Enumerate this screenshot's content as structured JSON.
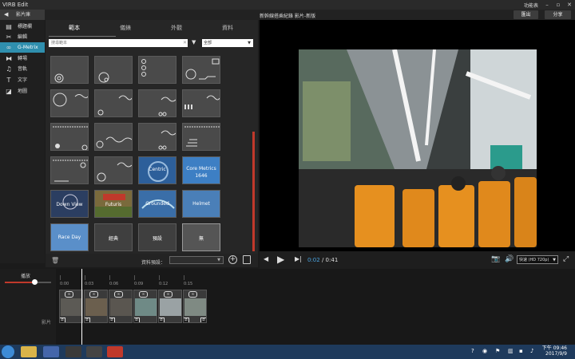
{
  "window": {
    "title": "VIRB Edit",
    "menu_label": "功能表",
    "minimize": "–",
    "maximize": "▫",
    "close": "✕"
  },
  "header": {
    "library_tab": "影片庫",
    "project_name": "新幹線搭乘紀錄 影片-新版",
    "exit_label": "匯出",
    "share_label": "分享"
  },
  "sidebar": {
    "items": [
      {
        "label": "標題欄",
        "icon": "film-strip-icon",
        "glyph": "▤"
      },
      {
        "label": "編輯",
        "icon": "scissors-icon",
        "glyph": "✂"
      },
      {
        "label": "G-Metrix",
        "icon": "gmetrix-icon",
        "glyph": "∞"
      },
      {
        "label": "轉場",
        "icon": "transition-icon",
        "glyph": "⧓"
      },
      {
        "label": "音軌",
        "icon": "music-icon",
        "glyph": "♫"
      },
      {
        "label": "文字",
        "icon": "text-icon",
        "glyph": "T"
      },
      {
        "label": "地圖",
        "icon": "map-icon",
        "glyph": "◪"
      }
    ]
  },
  "gauge_panel": {
    "tabs": [
      "範本",
      "儀錶",
      "外觀",
      "資料"
    ],
    "search_placeholder": "搜尋範本",
    "filter_value": "全部",
    "tiles": [
      {
        "kind": "gauge",
        "label": ""
      },
      {
        "kind": "gauge",
        "label": ""
      },
      {
        "kind": "gauge",
        "label": ""
      },
      {
        "kind": "gauge",
        "label": ""
      },
      {
        "kind": "gauge",
        "label": ""
      },
      {
        "kind": "gauge",
        "label": ""
      },
      {
        "kind": "gauge",
        "label": ""
      },
      {
        "kind": "gauge",
        "label": ""
      },
      {
        "kind": "gauge",
        "label": ""
      },
      {
        "kind": "gauge",
        "label": ""
      },
      {
        "kind": "gauge",
        "label": ""
      },
      {
        "kind": "gauge",
        "label": ""
      },
      {
        "kind": "gauge",
        "label": ""
      },
      {
        "kind": "gauge",
        "label": ""
      },
      {
        "kind": "photo",
        "label": "Centric"
      },
      {
        "kind": "photo",
        "label": "Core Metrics\n1646"
      },
      {
        "kind": "photo",
        "label": "Down View"
      },
      {
        "kind": "photo",
        "label": "Futuris"
      },
      {
        "kind": "photo",
        "label": "Grounded"
      },
      {
        "kind": "photo",
        "label": "Helmet"
      },
      {
        "kind": "photo",
        "label": "Race Day"
      },
      {
        "kind": "text",
        "label": "經典"
      },
      {
        "kind": "text",
        "label": "預設"
      },
      {
        "kind": "text",
        "label": "無"
      }
    ],
    "preset_label": "資料預設：",
    "preset_value": ""
  },
  "player": {
    "current_time": "0:02",
    "separator": " / ",
    "total_time": "0:41",
    "quality": "快速 (HD 720p)"
  },
  "timeline": {
    "speed_label": "播放",
    "track_label": "影片",
    "ticks": [
      "0:00",
      "0:03",
      "0:06",
      "0:09",
      "0:12",
      "0:15"
    ],
    "clip_count": 6
  },
  "taskbar": {
    "time": "下午 09:46",
    "date": "2017/9/9"
  },
  "colors": {
    "accent": "#2f8fae",
    "scroll_accent": "#c0392b",
    "time_blue": "#4aa3df"
  }
}
